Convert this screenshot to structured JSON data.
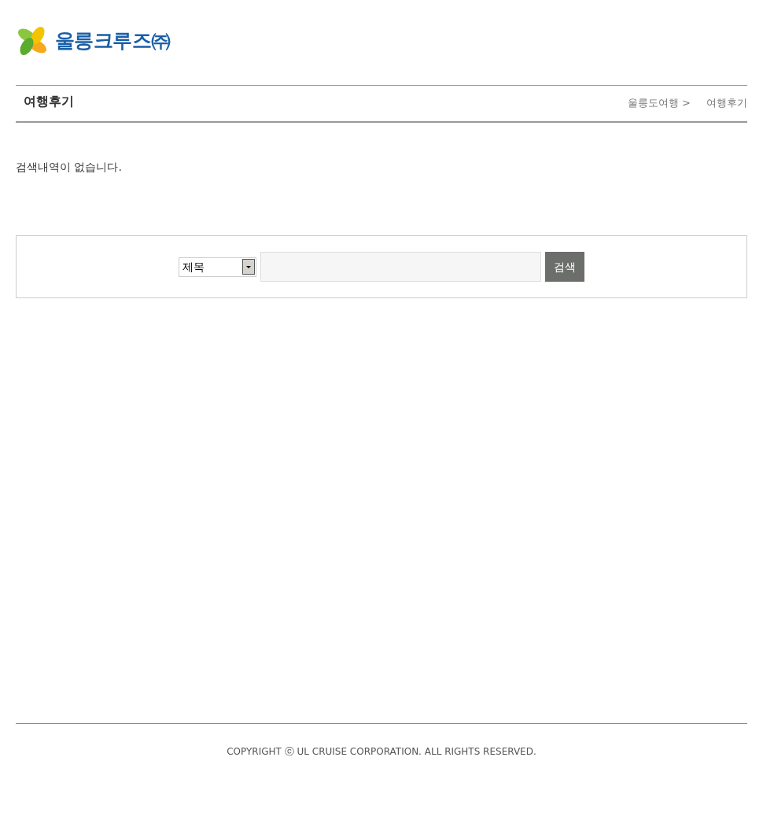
{
  "logo": {
    "text": "울릉크루즈㈜"
  },
  "header": {
    "title": "여행후기",
    "breadcrumb": [
      "울릉도여행 >",
      "여행후기"
    ]
  },
  "message": "검색내역이 없습니다.",
  "search": {
    "field_select": "제목",
    "button": "검색"
  },
  "footer": {
    "copyright": "COPYRIGHT ⓒ UL CRUISE CORPORATION. ALL RIGHTS RESERVED."
  }
}
